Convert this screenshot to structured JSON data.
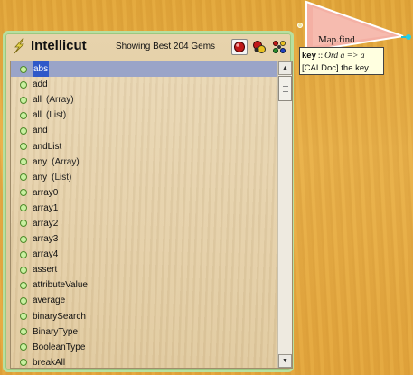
{
  "panel": {
    "title": "Intellicut",
    "gem_count_text": "Showing Best 204 Gems",
    "buttons": [
      {
        "name": "show-best-gems",
        "icon": "red-gem-icon"
      },
      {
        "name": "show-related-gems",
        "icon": "multi-gem-icon"
      },
      {
        "name": "show-all-gems",
        "icon": "gem-cluster-icon"
      }
    ]
  },
  "gems": [
    {
      "name": "abs",
      "qualifier": ""
    },
    {
      "name": "add",
      "qualifier": ""
    },
    {
      "name": "all",
      "qualifier": "(Array)"
    },
    {
      "name": "all",
      "qualifier": "(List)"
    },
    {
      "name": "and",
      "qualifier": ""
    },
    {
      "name": "andList",
      "qualifier": ""
    },
    {
      "name": "any",
      "qualifier": "(Array)"
    },
    {
      "name": "any",
      "qualifier": "(List)"
    },
    {
      "name": "array0",
      "qualifier": ""
    },
    {
      "name": "array1",
      "qualifier": ""
    },
    {
      "name": "array2",
      "qualifier": ""
    },
    {
      "name": "array3",
      "qualifier": ""
    },
    {
      "name": "array4",
      "qualifier": ""
    },
    {
      "name": "assert",
      "qualifier": ""
    },
    {
      "name": "attributeValue",
      "qualifier": ""
    },
    {
      "name": "average",
      "qualifier": ""
    },
    {
      "name": "binarySearch",
      "qualifier": ""
    },
    {
      "name": "BinaryType",
      "qualifier": ""
    },
    {
      "name": "BooleanType",
      "qualifier": ""
    },
    {
      "name": "breakAll",
      "qualifier": ""
    }
  ],
  "selected_index": 0,
  "scroll_position_fraction": 0.0,
  "map_gem": {
    "label": "Map.find"
  },
  "tooltip": {
    "key": "key",
    "separator": "::",
    "type_sig": "Ord a => a",
    "doc": "[CALDoc] the key."
  },
  "colors": {
    "table_wood": "#e3a93e",
    "panel_border": "#b8e0a0",
    "selection": "#2f58c9",
    "gem_triangle": "#f4b0a4",
    "tooltip_bg": "#ffffe0"
  }
}
